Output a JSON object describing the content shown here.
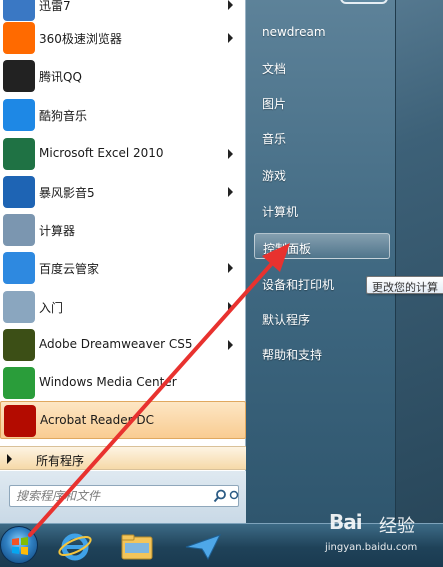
{
  "programs": [
    {
      "label": "迅雷7",
      "arrow": true,
      "icon": "thunder-icon",
      "color": "#3a78c4"
    },
    {
      "label": "360极速浏览器",
      "arrow": true,
      "icon": "browser-360-icon",
      "color": "#ff6a00"
    },
    {
      "label": "腾讯QQ",
      "arrow": false,
      "icon": "qq-penguin-icon",
      "color": "#222222"
    },
    {
      "label": "酷狗音乐",
      "arrow": false,
      "icon": "kugou-icon",
      "color": "#1e88e5"
    },
    {
      "label": "Microsoft Excel 2010",
      "arrow": true,
      "icon": "excel-icon",
      "color": "#1f7244"
    },
    {
      "label": "暴风影音5",
      "arrow": true,
      "icon": "baofeng-icon",
      "color": "#1e64b4"
    },
    {
      "label": "计算器",
      "arrow": false,
      "icon": "calculator-icon",
      "color": "#7b96b0"
    },
    {
      "label": "百度云管家",
      "arrow": true,
      "icon": "baidu-cloud-icon",
      "color": "#2e89e0"
    },
    {
      "label": "入门",
      "arrow": true,
      "icon": "getting-started-icon",
      "color": "#8aa6bf"
    },
    {
      "label": "Adobe Dreamweaver CS5",
      "arrow": true,
      "icon": "dreamweaver-icon",
      "color": "#3c4f16"
    },
    {
      "label": "Windows Media Center",
      "arrow": false,
      "icon": "windows-media-center-icon",
      "color": "#2a9d3a"
    },
    {
      "label": "Acrobat Reader DC",
      "arrow": false,
      "icon": "acrobat-icon",
      "color": "#b30b00"
    }
  ],
  "all_programs": "所有程序",
  "search": {
    "placeholder": "搜索程序和文件"
  },
  "right_links": [
    {
      "label": "newdream"
    },
    {
      "label": "文档"
    },
    {
      "label": "图片"
    },
    {
      "label": "音乐"
    },
    {
      "label": "游戏"
    },
    {
      "label": "计算机"
    },
    {
      "label": "控制面板"
    },
    {
      "label": "设备和打印机"
    },
    {
      "label": "默认程序"
    },
    {
      "label": "帮助和支持"
    }
  ],
  "tooltip": "更改您的计算",
  "watermark": {
    "logo": "Bai",
    "text": "经验",
    "url": "jingyan.baidu.com"
  },
  "colors": {
    "arrow": "#e8322f",
    "highlight": "#f9cc92"
  }
}
